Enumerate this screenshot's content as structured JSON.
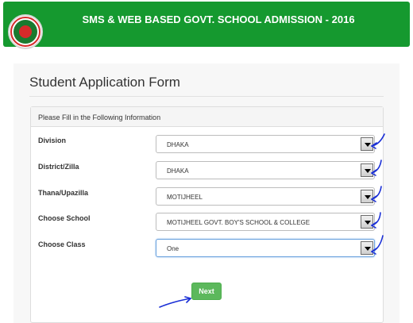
{
  "header": {
    "title": "SMS & WEB BASED GOVT. SCHOOL ADMISSION - 2016",
    "brand_color": "#15992f",
    "logo_icon": "government-seal-icon"
  },
  "page": {
    "title": "Student Application Form"
  },
  "form": {
    "panel_heading": "Please Fill in the Following Information",
    "fields": [
      {
        "label": "Division",
        "value": "DHAKA"
      },
      {
        "label": "District/Zilla",
        "value": "DHAKA"
      },
      {
        "label": "Thana/Upazilla",
        "value": "MOTIJHEEL"
      },
      {
        "label": "Choose School",
        "value": "MOTIJHEEL GOVT. BOY'S SCHOOL & COLLEGE"
      },
      {
        "label": "Choose Class",
        "value": "One"
      }
    ],
    "next_label": "Next",
    "next_color": "#5cb85c",
    "annotation_color": "#1a2fd6"
  }
}
